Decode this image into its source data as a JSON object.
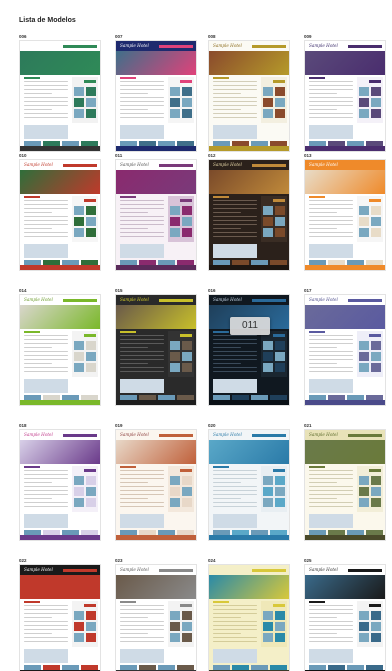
{
  "page": {
    "title": "Lista de Modelos"
  },
  "overlay": {
    "text": "011"
  },
  "templates": [
    {
      "num": "006",
      "logo": "",
      "theme": {
        "bg": "#ffffff",
        "header": "#ffffff",
        "hero": "#2d7a5b",
        "accent": "#2f8a57",
        "side": "#f2f2f2",
        "text": "#cfcfcf",
        "footer": "#333333",
        "logo": "#333333"
      }
    },
    {
      "num": "007",
      "logo": "Sample Hotel",
      "theme": {
        "bg": "#ffffff",
        "header": "#1e2a6e",
        "hero": "#3f6f8a",
        "accent": "#e0427a",
        "side": "#f5f5f5",
        "text": "#cfcfcf",
        "footer": "#1e2a6e",
        "logo": "#ffffff"
      }
    },
    {
      "num": "008",
      "logo": "Sample Hotel",
      "theme": {
        "bg": "#fbfaf4",
        "header": "#fbfaf4",
        "hero": "#8a4a2c",
        "accent": "#b59a2a",
        "side": "#f3efe0",
        "text": "#d3ceb9",
        "footer": "#b59a2a",
        "logo": "#8a6a1a"
      }
    },
    {
      "num": "009",
      "logo": "Sample Hotel",
      "theme": {
        "bg": "#ffffff",
        "header": "#ffffff",
        "hero": "#5a4a7a",
        "accent": "#4a2d6e",
        "side": "#f4f1f8",
        "text": "#cfcfcf",
        "footer": "#4a2d6e",
        "logo": "#3a2a6a"
      }
    },
    {
      "num": "010",
      "logo": "Sample Hotel",
      "theme": {
        "bg": "#ffffff",
        "header": "#ffffff",
        "hero": "#2f6e3a",
        "accent": "#c0392b",
        "side": "#f6f6f6",
        "text": "#cfcfcf",
        "footer": "#c0392b",
        "logo": "#c0392b"
      }
    },
    {
      "num": "011",
      "logo": "Sample Hotel",
      "theme": {
        "bg": "#f7f1f6",
        "header": "#ffffff",
        "hero": "#8a2a6e",
        "accent": "#7a3a7a",
        "side": "#d8c3d8",
        "text": "#cbbccb",
        "footer": "#5a2a5a",
        "logo": "#555555"
      }
    },
    {
      "num": "012",
      "logo": "Sample Hotel",
      "theme": {
        "bg": "#2b211b",
        "header": "#2b211b",
        "hero": "#7a4a2a",
        "accent": "#c08a3a",
        "side": "#3a2d24",
        "text": "#6a5a4e",
        "footer": "#1d1611",
        "logo": "#e8d8a8"
      }
    },
    {
      "num": "013",
      "logo": "Sample Hotel",
      "theme": {
        "bg": "#ffffff",
        "header": "#ef8a2a",
        "hero": "#e8dcc8",
        "accent": "#ef8a2a",
        "side": "#f6f6f6",
        "text": "#cfcfcf",
        "footer": "#ef8a2a",
        "logo": "#ffffff"
      }
    },
    {
      "num": "014",
      "logo": "Sample Hotel",
      "theme": {
        "bg": "#ffffff",
        "header": "#ffffff",
        "hero": "#d9d6cc",
        "accent": "#7ab82a",
        "side": "#f3f3f3",
        "text": "#cfcfcf",
        "footer": "#7ab82a",
        "logo": "#6a9a2a"
      }
    },
    {
      "num": "015",
      "logo": "Sample Hotel",
      "theme": {
        "bg": "#2a2a2a",
        "header": "#2a2a2a",
        "hero": "#6a5a4a",
        "accent": "#c8c02a",
        "side": "#333333",
        "text": "#5a5a5a",
        "footer": "#1e1e1e",
        "logo": "#d8d02a"
      }
    },
    {
      "num": "016",
      "logo": "Sample Hotel",
      "theme": {
        "bg": "#101820",
        "header": "#101820",
        "hero": "#1f3f5a",
        "accent": "#2a6a9a",
        "side": "#1a2630",
        "text": "#3a4a5a",
        "footer": "#0a1016",
        "logo": "#c8d8e8"
      }
    },
    {
      "num": "017",
      "logo": "Sample Hotel",
      "theme": {
        "bg": "#ffffff",
        "header": "#ffffff",
        "hero": "#6a6a9a",
        "accent": "#5a5aa0",
        "side": "#eeeef8",
        "text": "#cfcfcf",
        "footer": "#4a4a8a",
        "logo": "#4a4a8a"
      }
    },
    {
      "num": "018",
      "logo": "Sample Hotel",
      "theme": {
        "bg": "#ffffff",
        "header": "#ffffff",
        "hero": "#d8d0e8",
        "accent": "#6a3a8a",
        "side": "#f4f0f8",
        "text": "#cfcfcf",
        "footer": "#6a3a8a",
        "logo": "#c0398a"
      }
    },
    {
      "num": "019",
      "logo": "Sample Hotel",
      "theme": {
        "bg": "#fbf6ef",
        "header": "#fbf6ef",
        "hero": "#e8d8c8",
        "accent": "#c0603a",
        "side": "#f3e8dc",
        "text": "#d6c6b6",
        "footer": "#c0603a",
        "logo": "#8a3a3a"
      }
    },
    {
      "num": "020",
      "logo": "Sample Hotel",
      "theme": {
        "bg": "#f2f5f7",
        "header": "#f2f5f7",
        "hero": "#5aa8c8",
        "accent": "#2a7aa8",
        "side": "#e8eef2",
        "text": "#c8d2d8",
        "footer": "#2a7aa8",
        "logo": "#2a7aa8"
      }
    },
    {
      "num": "021",
      "logo": "Sample Hotel",
      "theme": {
        "bg": "#fbf8ec",
        "header": "#e8e2b8",
        "hero": "#6a7a4a",
        "accent": "#6a7a3a",
        "side": "#f2eed8",
        "text": "#d2ceb4",
        "footer": "#4a4a2a",
        "logo": "#5a6a2a"
      }
    },
    {
      "num": "022",
      "logo": "Sample Hotel",
      "theme": {
        "bg": "#ffffff",
        "header": "#1a1a1a",
        "hero": "#c0392b",
        "accent": "#c0392b",
        "side": "#f3f3f3",
        "text": "#cfcfcf",
        "footer": "#1a1a1a",
        "logo": "#ffffff"
      }
    },
    {
      "num": "023",
      "logo": "Sample Hotel",
      "theme": {
        "bg": "#ffffff",
        "header": "#ffffff",
        "hero": "#6a5a4a",
        "accent": "#8a8a8a",
        "side": "#f3f3f3",
        "text": "#cfcfcf",
        "footer": "#333333",
        "logo": "#555555"
      }
    },
    {
      "num": "024",
      "logo": "",
      "theme": {
        "bg": "#f4efc8",
        "header": "#f4efc8",
        "hero": "#2a8aa8",
        "accent": "#d8c83a",
        "side": "#efe8b8",
        "text": "#d4cc9a",
        "footer": "#3a3a2a",
        "logo": "#555555"
      }
    },
    {
      "num": "025",
      "logo": "Sample Hotel",
      "theme": {
        "bg": "#ffffff",
        "header": "#ffffff",
        "hero": "#3a6a8a",
        "accent": "#1a1a1a",
        "side": "#f3f3f3",
        "text": "#cfcfcf",
        "footer": "#111111",
        "logo": "#333333"
      }
    }
  ]
}
